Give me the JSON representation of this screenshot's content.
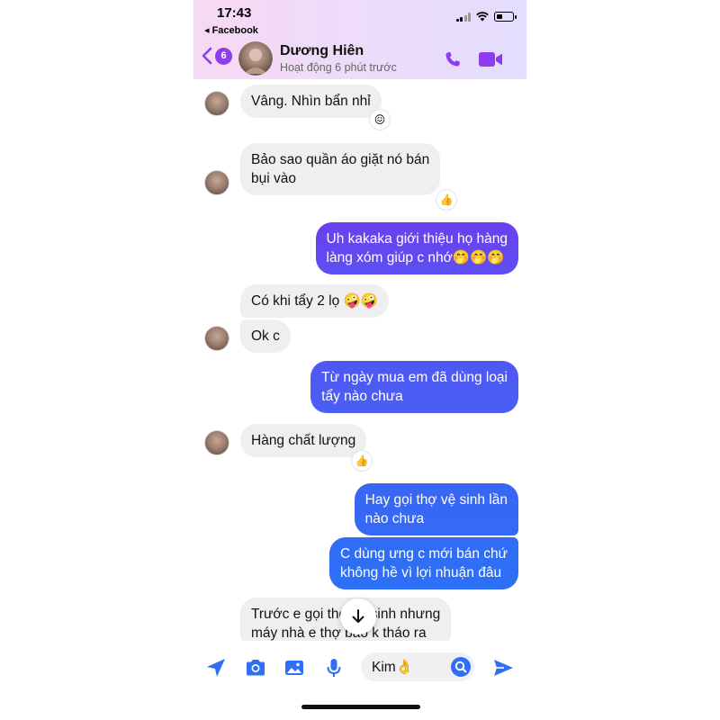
{
  "status_bar": {
    "time": "17:43",
    "back_app": "◂ Facebook"
  },
  "header": {
    "back_count": "6",
    "name": "Dương Hiên",
    "status": "Hoạt động 6 phút trước",
    "call_icon": "phone-icon",
    "video_icon": "video-camera-icon"
  },
  "colors": {
    "accent": "#8e3bf2",
    "outgoing_start": "#6d3fea",
    "outgoing_end": "#2a6cf4",
    "incoming": "#efeff1"
  },
  "messages": [
    {
      "side": "in",
      "lines": [
        "Vâng. Nhìn bẩn nhỉ"
      ],
      "reaction": "😖"
    },
    {
      "side": "in",
      "lines": [
        "Bảo sao quần áo giặt nó bán",
        "bụi vào"
      ],
      "reaction": "👍"
    },
    {
      "side": "out",
      "lines": [
        "Uh kakaka giới thiệu họ hàng",
        "làng xóm giúp c nhớ🤭🤭🤭"
      ]
    },
    {
      "side": "in",
      "lines": [
        "Có khi tẩy 2 lọ 🤪🤪"
      ]
    },
    {
      "side": "in",
      "lines": [
        "Ok c"
      ]
    },
    {
      "side": "out",
      "lines": [
        "Từ ngày mua em đã dùng loại",
        "tẩy nào chưa"
      ]
    },
    {
      "side": "in",
      "lines": [
        "Hàng chất lượng"
      ],
      "reaction": "👍"
    },
    {
      "side": "out",
      "lines": [
        "Hay gọi thợ vệ sinh lần",
        "nào chưa"
      ]
    },
    {
      "side": "out",
      "lines": [
        "C dùng ưng c mới bán chứ",
        "không hề vì lợi nhuận đâu"
      ]
    },
    {
      "side": "in",
      "lines": [
        "Trước e gọi thợ vệ sinh nhưng",
        "máy nhà e thợ bảo k tháo ra"
      ]
    }
  ],
  "composer": {
    "input_value": "Kim👌",
    "icons": [
      "location-arrow-icon",
      "camera-icon",
      "gallery-icon",
      "microphone-icon",
      "search-icon",
      "send-icon"
    ]
  }
}
